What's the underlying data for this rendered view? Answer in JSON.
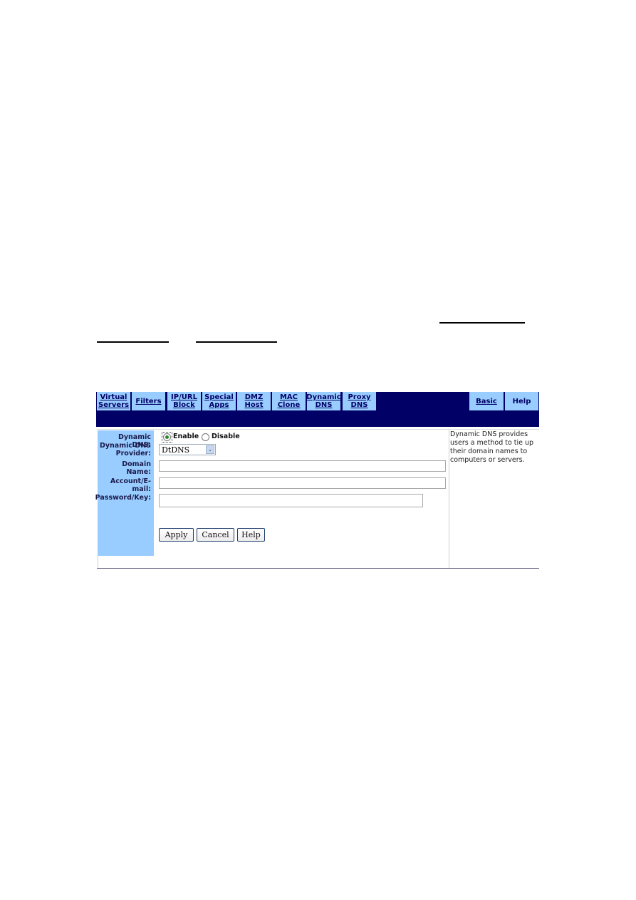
{
  "document": {
    "link_underlines": [
      "",
      "",
      ""
    ]
  },
  "nav": {
    "tabs": [
      {
        "line1": "Virtual",
        "line2": "Servers"
      },
      {
        "line1": "Filters",
        "line2": ""
      },
      {
        "line1": "IP/URL",
        "line2": "Block"
      },
      {
        "line1": "Special",
        "line2": "Apps"
      },
      {
        "line1": "DMZ",
        "line2": "Host"
      },
      {
        "line1": "MAC",
        "line2": "Clone"
      },
      {
        "line1": "Dynamic",
        "line2": "DNS"
      },
      {
        "line1": "Proxy",
        "line2": "DNS"
      }
    ],
    "right_tabs": [
      {
        "label": "Basic"
      },
      {
        "label": "Help"
      }
    ]
  },
  "form": {
    "dynamic_dns_label": "Dynamic DNS:",
    "enable_label": "Enable",
    "disable_label": "Disable",
    "dynamic_dns_state": "Enable",
    "provider_label_1": "Dynamic DNS",
    "provider_label_2": "Provider:",
    "provider_value": "DtDNS",
    "domain_name_label": "Domain Name:",
    "domain_name_value": "",
    "account_label_1": "Account/E-",
    "account_label_2": "mail:",
    "account_value": "",
    "password_label": "Password/Key:",
    "password_value": ""
  },
  "buttons": {
    "apply": "Apply",
    "cancel": "Cancel",
    "help": "Help"
  },
  "help_panel": {
    "text": "Dynamic DNS provides users a method to tie up their domain names to computers or servers."
  },
  "colors": {
    "navy": "#000066",
    "tab_blue": "#99ccff"
  }
}
